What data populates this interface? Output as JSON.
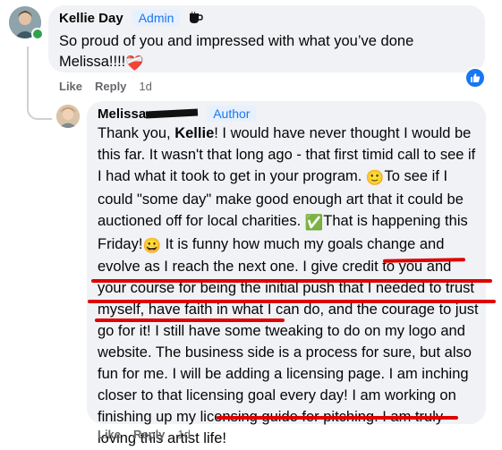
{
  "comment1": {
    "author": "Kellie Day",
    "role_badge": "Admin",
    "badge_icon": "coffee-icon",
    "text_before_emoji": "So proud of you and impressed with what you’ve done Melissa!!!!",
    "emoji": "❤️‍🩹",
    "actions": {
      "like": "Like",
      "reply": "Reply",
      "time": "1d"
    },
    "reaction_icon": "thumbs-up-icon"
  },
  "comment2": {
    "author": "Melissa",
    "role_badge": "Author",
    "segments": {
      "s1": "Thank you, ",
      "s1_bold": "Kellie",
      "s2": "! I would have never thought I would be this far. It wasn't that long ago - that first timid call to see if I had what it took to get in your program. ",
      "e1": "🙂",
      "s3": "To see if I could \"some day\" make good enough art that it could be auctioned off for local charities. ",
      "e2": "✅",
      "s4": "That is happening this Friday!",
      "e3": "😀",
      "s5": " It is funny how much my goals change and evolve as I reach the next one. I give credit to you and your course for being the initial push that I needed to trust myself, have faith in what I can do, and the courage to just go for it! I still have some tweaking to do on my logo and website. The business side is a process for sure, but also fun for me. I will be adding a licensing page. I am inching closer to that licensing goal every day! I am working on finishing up my licensing guide for pitching. I am truly loving this artist life!"
    },
    "actions": {
      "like": "Like",
      "reply": "Reply",
      "time": "1d"
    }
  },
  "colors": {
    "accent": "#1877f2",
    "bubble": "#f0f2f5",
    "underline": "#e00000",
    "online": "#31a24c"
  }
}
